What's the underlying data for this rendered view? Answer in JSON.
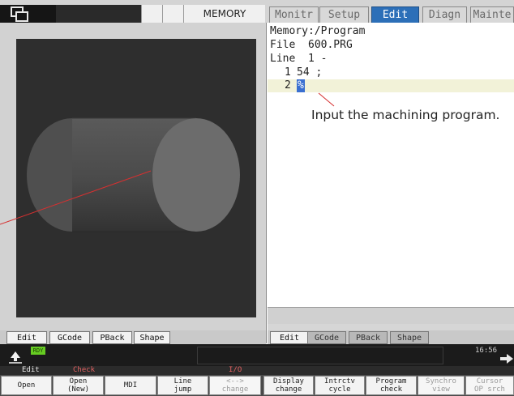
{
  "header": {
    "mode": "MEMORY",
    "tabs": [
      {
        "label": "Monitr",
        "active": false
      },
      {
        "label": "Setup",
        "active": false
      },
      {
        "label": "Edit",
        "active": true
      },
      {
        "label": "Diagn",
        "active": false
      },
      {
        "label": "Mainte",
        "active": false
      }
    ]
  },
  "editor": {
    "path": "Memory:/Program",
    "file_label": "File",
    "file_name": "600.PRG",
    "line_label": "Line",
    "line_value": "1 -",
    "lines": [
      {
        "num": "1",
        "text": "54 ;"
      },
      {
        "num": "2",
        "text": "%"
      }
    ],
    "annotation": "Input the machining program."
  },
  "left_tabs": [
    "Edit",
    "GCode",
    "PBack",
    "Shape"
  ],
  "right_tabs": [
    "Edit",
    "GCode",
    "PBack",
    "Shape"
  ],
  "status": {
    "ready": "RDY",
    "time": "16:56"
  },
  "function_labels": {
    "edit": "Edit",
    "check": "Check",
    "io": "I/O"
  },
  "softkeys": [
    {
      "label": "Open",
      "enabled": true
    },
    {
      "label": "Open\n(New)",
      "enabled": true
    },
    {
      "label": "MDI",
      "enabled": true
    },
    {
      "label": "Line\njump",
      "enabled": true
    },
    {
      "label": "<-->\nchange",
      "enabled": false
    },
    {
      "label": "Display\nchange",
      "enabled": true
    },
    {
      "label": "Intrctv\ncycle",
      "enabled": true
    },
    {
      "label": "Program\ncheck",
      "enabled": true
    },
    {
      "label": "Synchro\nview",
      "enabled": false
    },
    {
      "label": "Cursor\nOP srch",
      "enabled": false
    }
  ],
  "colors": {
    "active_tab": "#2c6fb8",
    "ready": "#66cc22",
    "check_label": "#e06060",
    "annotation_line": "#d63030"
  }
}
